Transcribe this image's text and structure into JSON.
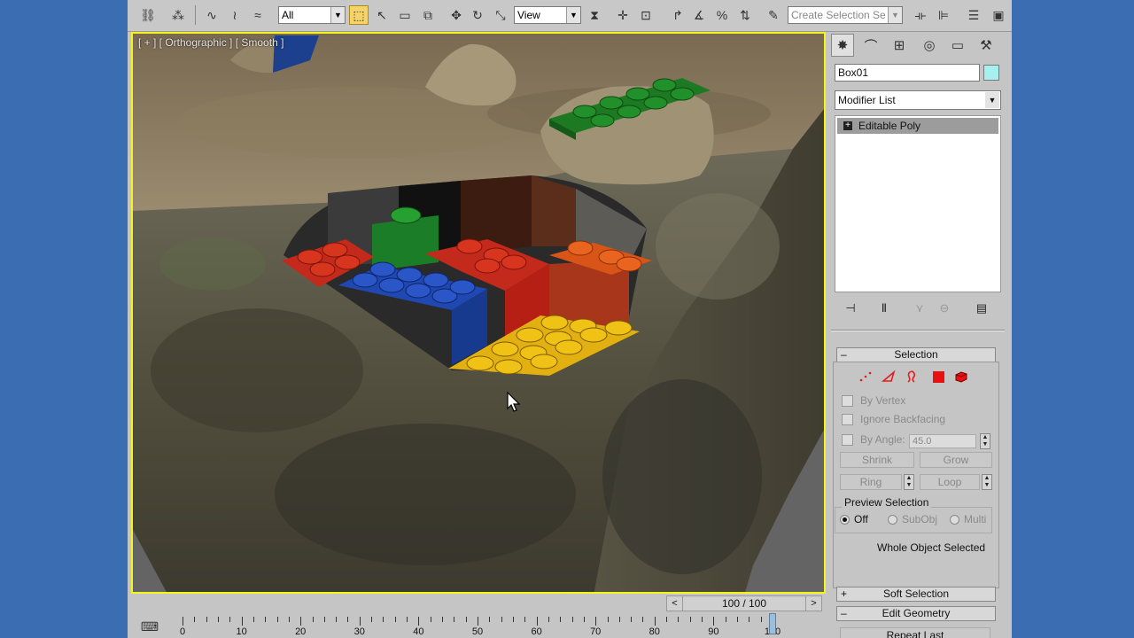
{
  "toolbar": {
    "filter_value": "All",
    "ref_coord_value": "View",
    "selection_set_placeholder": "Create Selection Se"
  },
  "viewport": {
    "label": "[ + ] [ Orthographic ] [ Smooth ]"
  },
  "command_panel": {
    "object_name": "Box01",
    "object_color": "#a8f0ee",
    "modifier_list": "Modifier List",
    "stack_item": "Editable Poly",
    "selection_rollout": {
      "title": "Selection",
      "by_vertex": "By Vertex",
      "ignore_backfacing": "Ignore Backfacing",
      "by_angle": "By Angle:",
      "angle_value": "45.0",
      "shrink": "Shrink",
      "grow": "Grow",
      "ring": "Ring",
      "loop": "Loop",
      "preview_selection": "Preview Selection",
      "preview_off": "Off",
      "preview_subobj": "SubObj",
      "preview_multi": "Multi",
      "status": "Whole Object Selected"
    },
    "soft_selection": "Soft Selection",
    "edit_geometry": "Edit Geometry",
    "repeat_last": "Repeat Last"
  },
  "timeline": {
    "frame_display": "100 / 100",
    "ticks": [
      "0",
      "10",
      "20",
      "30",
      "40",
      "50",
      "60",
      "70",
      "80",
      "90",
      "100"
    ]
  }
}
